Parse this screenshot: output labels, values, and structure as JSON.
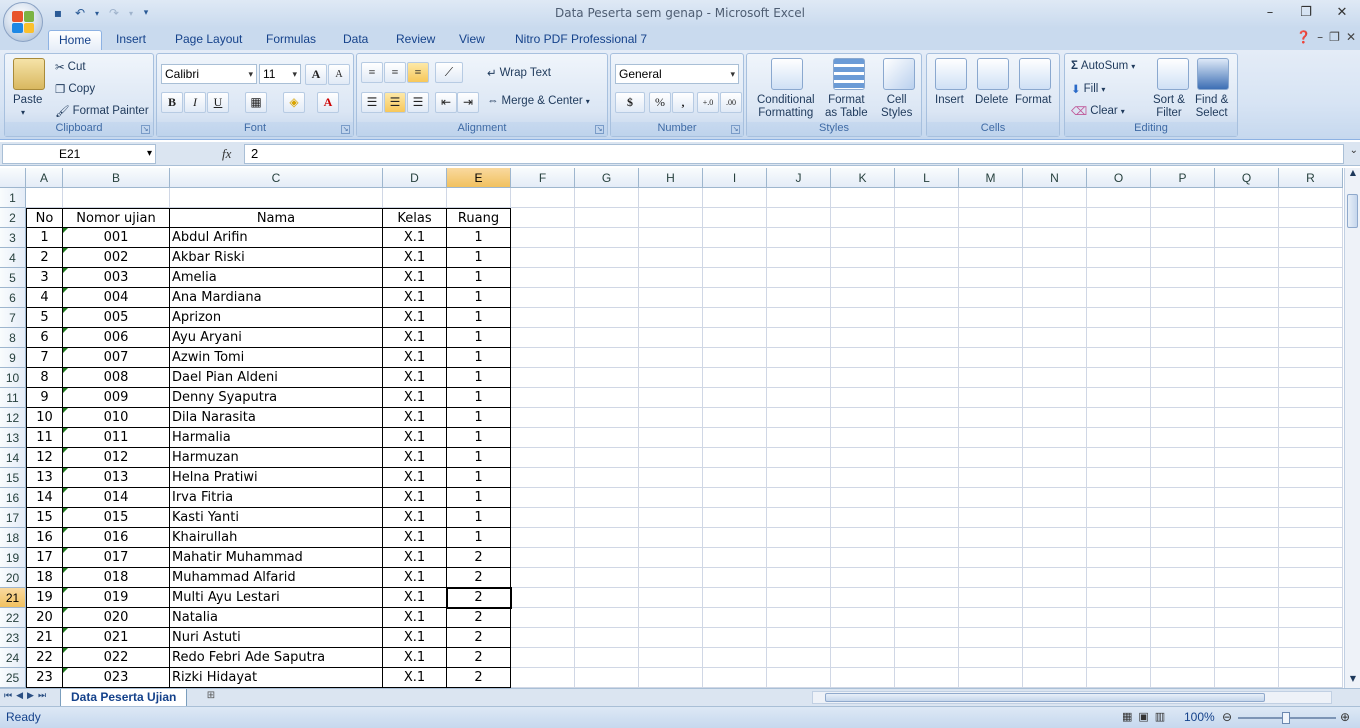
{
  "window": {
    "title": "Data Peserta sem genap - Microsoft Excel"
  },
  "tabs": [
    "Home",
    "Insert",
    "Page Layout",
    "Formulas",
    "Data",
    "Review",
    "View",
    "Nitro PDF Professional 7"
  ],
  "clipboard": {
    "paste": "Paste",
    "cut": "Cut",
    "copy": "Copy",
    "format_painter": "Format Painter",
    "label": "Clipboard"
  },
  "font": {
    "name": "Calibri",
    "size": "11",
    "label": "Font",
    "bold": "B",
    "italic": "I",
    "underline": "U",
    "grow": "A",
    "shrink": "A",
    "color_letter": "A"
  },
  "alignment": {
    "wrap": "Wrap Text",
    "merge": "Merge & Center",
    "label": "Alignment"
  },
  "number": {
    "format": "General",
    "currency": "$",
    "percent": "%",
    "comma": ",",
    "inc": "+.0",
    "dec": ".00",
    "label": "Number"
  },
  "styles": {
    "conditional": [
      "Conditional",
      "Formatting"
    ],
    "table": [
      "Format",
      "as Table"
    ],
    "cell": [
      "Cell",
      "Styles"
    ],
    "label": "Styles"
  },
  "cells": {
    "insert": "Insert",
    "delete": "Delete",
    "format": "Format",
    "label": "Cells"
  },
  "editing": {
    "autosum": "AutoSum",
    "fill": "Fill",
    "clear": "Clear",
    "sort": [
      "Sort &",
      "Filter"
    ],
    "find": [
      "Find &",
      "Select"
    ],
    "label": "Editing",
    "sigma": "Σ"
  },
  "formula_bar": {
    "name_box": "E21",
    "fx": "fx",
    "value": "2"
  },
  "columns": [
    "A",
    "B",
    "C",
    "D",
    "E",
    "F",
    "G",
    "H",
    "I",
    "J",
    "K",
    "L",
    "M",
    "N",
    "O",
    "P",
    "Q",
    "R"
  ],
  "rows": [
    "1",
    "2",
    "3",
    "4",
    "5",
    "6",
    "7",
    "8",
    "9",
    "10",
    "11",
    "12",
    "13",
    "14",
    "15",
    "16",
    "17",
    "18",
    "19",
    "20",
    "21",
    "22",
    "23",
    "24",
    "25"
  ],
  "table": {
    "headers": [
      "No",
      "Nomor ujian",
      "Nama",
      "Kelas",
      "Ruang"
    ],
    "data": [
      [
        "1",
        "001",
        "Abdul Arifin",
        "X.1",
        "1"
      ],
      [
        "2",
        "002",
        "Akbar Riski",
        "X.1",
        "1"
      ],
      [
        "3",
        "003",
        "Amelia",
        "X.1",
        "1"
      ],
      [
        "4",
        "004",
        "Ana Mardiana",
        "X.1",
        "1"
      ],
      [
        "5",
        "005",
        "Aprizon",
        "X.1",
        "1"
      ],
      [
        "6",
        "006",
        "Ayu Aryani",
        "X.1",
        "1"
      ],
      [
        "7",
        "007",
        "Azwin Tomi",
        "X.1",
        "1"
      ],
      [
        "8",
        "008",
        "Dael Pian Aldeni",
        "X.1",
        "1"
      ],
      [
        "9",
        "009",
        "Denny Syaputra",
        "X.1",
        "1"
      ],
      [
        "10",
        "010",
        "Dila Narasita",
        "X.1",
        "1"
      ],
      [
        "11",
        "011",
        "Harmalia",
        "X.1",
        "1"
      ],
      [
        "12",
        "012",
        "Harmuzan",
        "X.1",
        "1"
      ],
      [
        "13",
        "013",
        "Helna Pratiwi",
        "X.1",
        "1"
      ],
      [
        "14",
        "014",
        "Irva Fitria",
        "X.1",
        "1"
      ],
      [
        "15",
        "015",
        "Kasti Yanti",
        "X.1",
        "1"
      ],
      [
        "16",
        "016",
        "Khairullah",
        "X.1",
        "1"
      ],
      [
        "17",
        "017",
        "Mahatir Muhammad",
        "X.1",
        "2"
      ],
      [
        "18",
        "018",
        "Muhammad Alfarid",
        "X.1",
        "2"
      ],
      [
        "19",
        "019",
        "Multi Ayu Lestari",
        "X.1",
        "2"
      ],
      [
        "20",
        "020",
        "Natalia",
        "X.1",
        "2"
      ],
      [
        "21",
        "021",
        "Nuri Astuti",
        "X.1",
        "2"
      ],
      [
        "22",
        "022",
        "Redo Febri Ade Saputra",
        "X.1",
        "2"
      ],
      [
        "23",
        "023",
        "Rizki Hidayat",
        "X.1",
        "2"
      ]
    ]
  },
  "sheet_tab": "Data Peserta Ujian",
  "status": {
    "ready": "Ready",
    "zoom": "100%"
  }
}
